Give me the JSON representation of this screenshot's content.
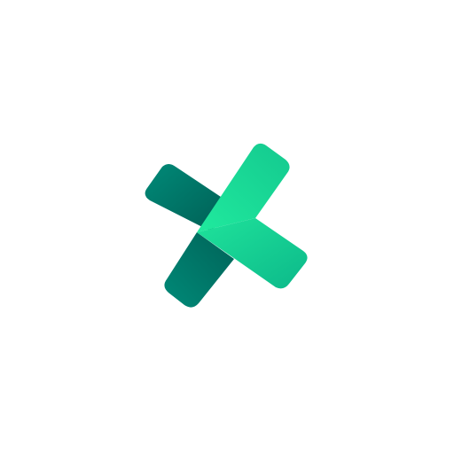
{
  "background": "#ffffff",
  "logo": {
    "icon": "cross-logo-icon",
    "colors": {
      "dark_teal": "#006b5f",
      "teal": "#008a78",
      "mid_green": "#0fbf8c",
      "bright_green": "#1ee89d"
    }
  }
}
